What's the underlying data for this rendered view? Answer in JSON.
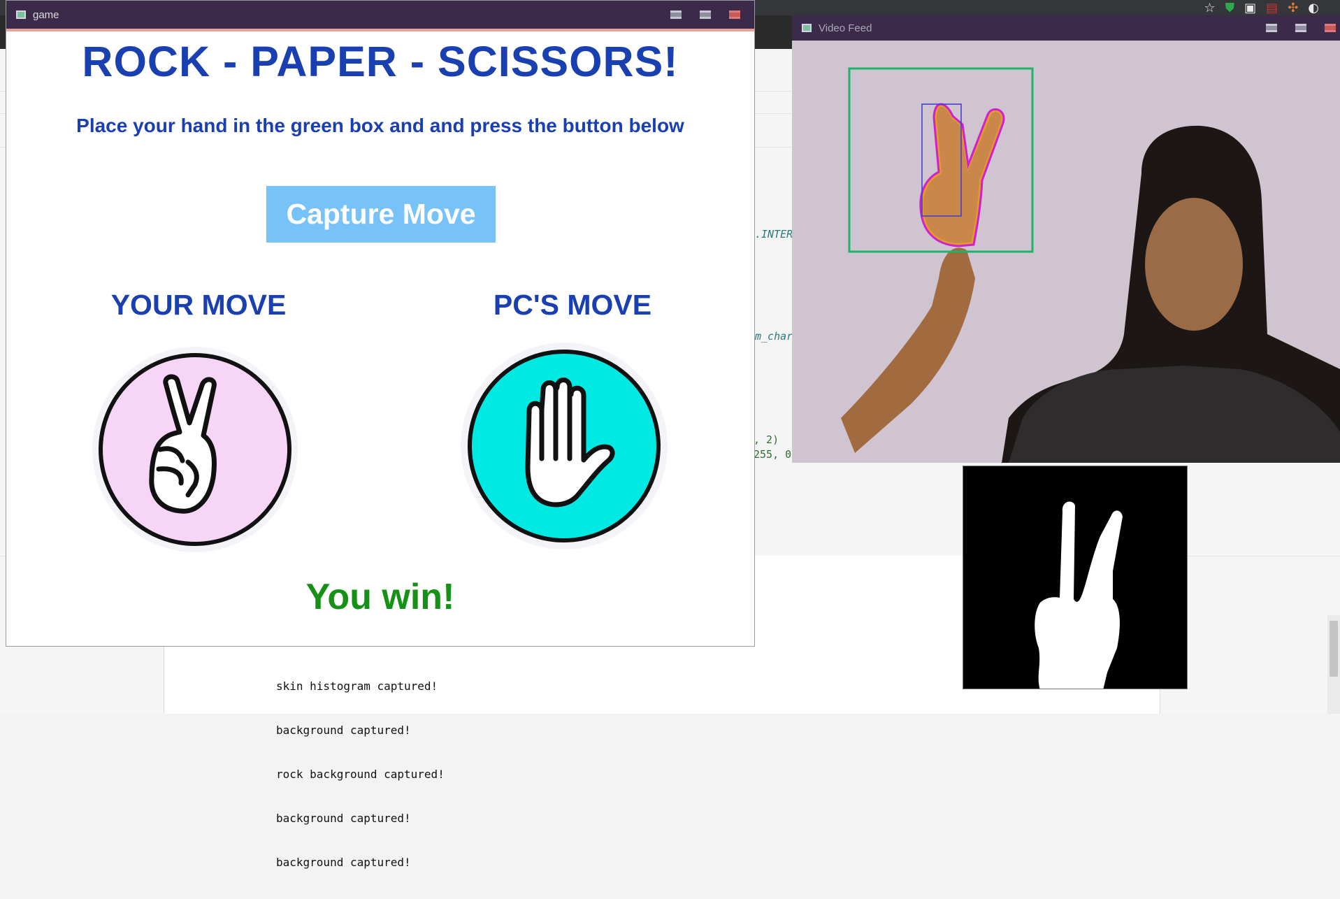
{
  "game_window": {
    "title": "game",
    "heading": "ROCK - PAPER - SCISSORS!",
    "instruction": "Place your hand in the green box and and press the button below",
    "capture_button": "Capture Move",
    "your_move_label": "YOUR MOVE",
    "pc_move_label": "PC'S MOVE",
    "your_move_icon": "scissors-hand-icon",
    "pc_move_icon": "paper-hand-icon",
    "your_move_color": "#f6d5f6",
    "pc_move_color": "#00e9e3",
    "result": "You win!",
    "result_color": "#169015",
    "heading_color": "#1a3fb0",
    "button_color": "#78c2fa"
  },
  "video_window": {
    "title": "Video Feed",
    "roi_box_color": "#1db36a",
    "bounding_box_color": "#3a3ad0",
    "contour_color": "#d020d0"
  },
  "mask_window": {
    "icon": "scissors-mask-silhouette"
  },
  "editor": {
    "frag_1": ".INTER",
    "frag_2": "m_char",
    "frag_3": ", 2)",
    "frag_4": "255, 0"
  },
  "console": {
    "lines": [
      "skin histogram captured!",
      "background captured!",
      "rock background captured!",
      "background captured!",
      "background captured!"
    ]
  },
  "browser": {
    "icons": [
      "star-icon",
      "shield-check-icon",
      "tab-icon",
      "pdf-icon",
      "extensions-icon",
      "profile-icon"
    ]
  }
}
